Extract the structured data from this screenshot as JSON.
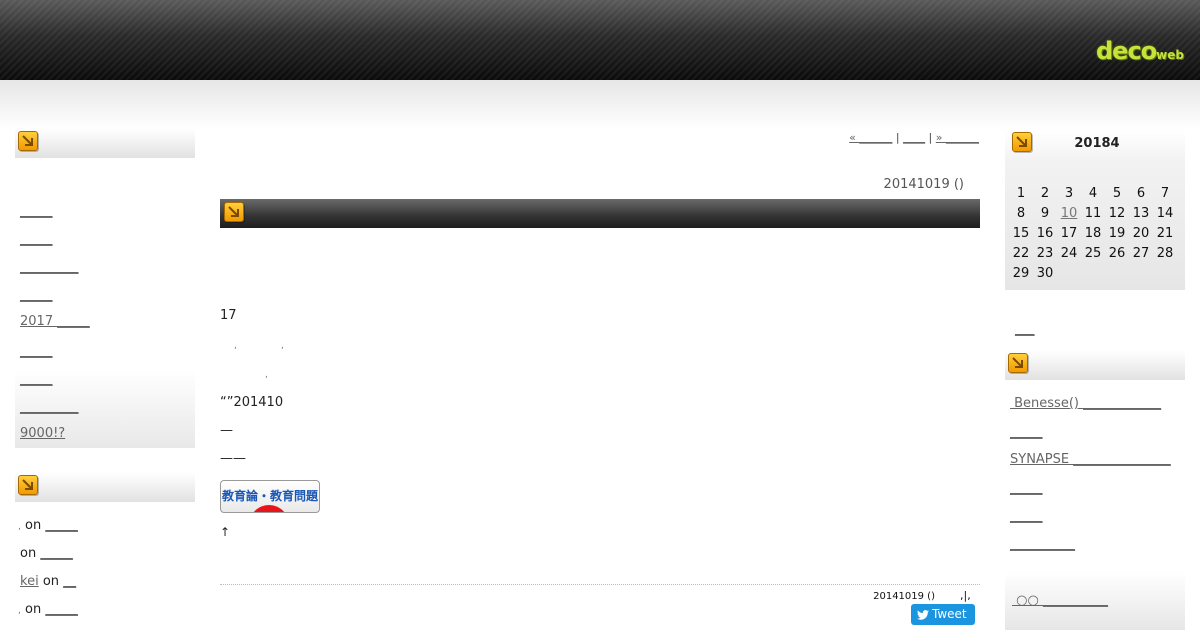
{
  "header": {
    "logo_main": "deco",
    "logo_sub": "web"
  },
  "left_sidebar": {
    "links": [
      "_____",
      "_____",
      "_________",
      "_____",
      "2017 _____",
      "_____",
      "_____",
      "_________",
      "9000!? "
    ],
    "comments": [
      {
        "author": ",",
        "on": " on ",
        "post": "_____"
      },
      {
        "author": "",
        "on": "on ",
        "post": "_____"
      },
      {
        "author": "kei",
        "on": " on ",
        "post": "__"
      },
      {
        "author": ",",
        "on": " on ",
        "post": "_____"
      }
    ]
  },
  "pager": {
    "prev": "« ______",
    "sep1": " | ",
    "index": "____",
    "sep2": " | ",
    "next": "» ______"
  },
  "post": {
    "date_top": "20141019 ()",
    "paragraphs": [
      "17",
      "“”201410",
      "—",
      "——",
      "↑"
    ],
    "tiny_marks": [
      ",",
      ",",
      ","
    ],
    "badge_text": "教育論・教育問題",
    "footer_date": "20141019 ()",
    "footer_sep": ",|,",
    "tweet_label": "Tweet"
  },
  "calendar": {
    "title": "20184",
    "weeks": [
      [
        "1",
        "2",
        "3",
        "4",
        "5",
        "6",
        "7"
      ],
      [
        "8",
        "9",
        "10",
        "11",
        "12",
        "13",
        "14"
      ],
      [
        "15",
        "16",
        "17",
        "18",
        "19",
        "20",
        "21"
      ],
      [
        "22",
        "23",
        "24",
        "25",
        "26",
        "27",
        "28"
      ],
      [
        "29",
        "30",
        "",
        "",
        "",
        "",
        ""
      ]
    ],
    "linked_day": "10"
  },
  "right_sidebar": {
    "under_calendar_link": "___",
    "links": [
      " Benesse() ____________",
      "_____",
      "SYNAPSE _______________",
      "_____",
      "_____",
      "__________"
    ],
    "bottom_link": " ○○ __________"
  },
  "colors": {
    "accent_orange": "#f29a00",
    "logo_green": "#c8e23c",
    "tweet_blue": "#1b95e0"
  }
}
